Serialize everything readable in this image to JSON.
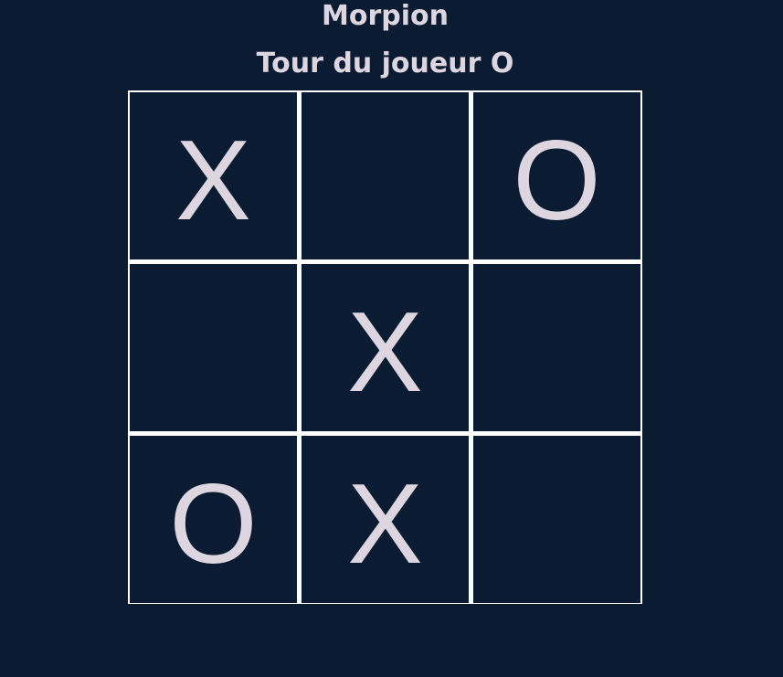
{
  "game": {
    "title": "Morpion",
    "status": "Tour du joueur O"
  },
  "board": {
    "cells": [
      "X",
      "",
      "O",
      "",
      "X",
      "",
      "O",
      "X",
      ""
    ]
  },
  "colors": {
    "background": "#0b1c32",
    "grid_lines": "#ffffff",
    "text": "#ddd6e1"
  }
}
